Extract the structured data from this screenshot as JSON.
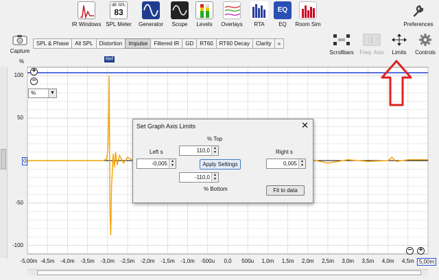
{
  "toolbar": {
    "ir_windows": "IR Windows",
    "spl_meter": "SPL Meter",
    "spl_sub": "dB SPL",
    "spl_value": "83",
    "generator": "Generator",
    "scope": "Scope",
    "levels": "Levels",
    "overlays": "Overlays",
    "rta": "RTA",
    "eq": "EQ",
    "eq_icon_text": "EQ",
    "room_sim": "Room Sim",
    "preferences": "Preferences"
  },
  "capture_label": "Capture",
  "tabs": [
    "SPL & Phase",
    "All SPL",
    "Distortion",
    "Impulse",
    "Filtered IR",
    "GD",
    "RT60",
    "RT60 Decay",
    "Clarity",
    "»"
  ],
  "active_tab": "Impulse",
  "right_controls": {
    "scrollbars": "Scrollbars",
    "freq_axis": "Freq. Axis",
    "limits": "Limits",
    "controls": "Controls"
  },
  "graph": {
    "y_unit": "%",
    "unit_select": "%",
    "ref_flag": "Ref",
    "zero_marker": "0",
    "y_ticks": [
      "100",
      "50",
      "0",
      "-50",
      "-100"
    ],
    "x_ticks": [
      "-5,00m",
      "-4,5m",
      "-4,0m",
      "-3,5m",
      "-3,0m",
      "-2,5m",
      "-2,0m",
      "-1,5m",
      "-1,0m",
      "-500u",
      "0,0",
      "500u",
      "1,0m",
      "1,5m",
      "2,0m",
      "2,5m",
      "3,0m",
      "3,5m",
      "4,0m",
      "4,5m",
      "5,00m"
    ]
  },
  "chart_data": {
    "type": "line",
    "ylabel": "%",
    "ylim": [
      -110,
      110
    ],
    "xlim": [
      -0.005,
      0.005
    ],
    "x_unit": "s",
    "grid": true,
    "colors": {
      "trace": "#f5a000",
      "limit_line": "#1f3fd0",
      "grid": "#d0d0d0"
    },
    "series": [
      {
        "x": [
          -0.005,
          -0.0031,
          -0.00302,
          -0.00299,
          -0.00297,
          -0.00296,
          -0.00295,
          -0.00294,
          -0.00292,
          -0.0029,
          -0.00288,
          -0.00286,
          -0.00283,
          -0.0028,
          -0.00276,
          -0.0027,
          -0.0026,
          -0.0025,
          -0.0023,
          -0.002,
          -0.0017,
          -0.0014,
          -0.001,
          -0.0005,
          0.0,
          0.0005,
          0.001,
          0.0015,
          0.002,
          0.0025,
          0.003,
          0.0035,
          0.004,
          0.0041,
          0.0042,
          0.0045,
          0.005
        ],
        "y": [
          0,
          0,
          2,
          15,
          60,
          100,
          30,
          -60,
          -88,
          -30,
          -12,
          8,
          -8,
          10,
          -5,
          6,
          -3,
          4,
          -2,
          2,
          -1,
          1,
          0,
          1,
          0,
          1,
          3,
          -2,
          2,
          -3,
          1,
          -1,
          0,
          4,
          -1,
          1,
          1
        ]
      }
    ]
  },
  "dialog": {
    "title": "Set Graph Axis Limits",
    "close": "✕",
    "top_label": "%     Top",
    "top_value": "110,0",
    "left_label": "Left s",
    "left_value": "-0,005",
    "right_label": "Right s",
    "right_value": "0,005",
    "apply_label": "Apply Settings",
    "bottom_value": "-110,0",
    "bottom_label": "%     Bottom",
    "fit_label": "Fit to data"
  }
}
